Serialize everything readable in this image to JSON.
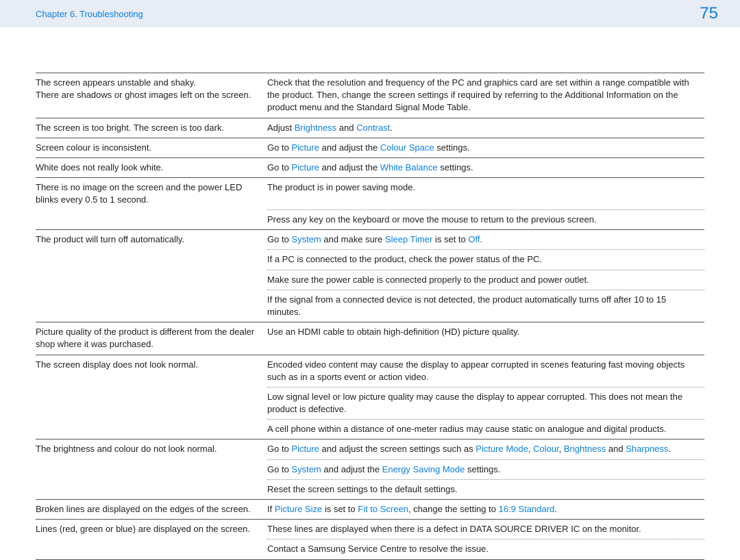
{
  "header": {
    "chapter": "Chapter 6. Troubleshooting",
    "page": "75"
  },
  "rows": [
    {
      "issue": "The screen appears unstable and shaky.\nThere are shadows or ghost images left on the screen.",
      "solutions": [
        {
          "segments": [
            {
              "t": "Check that the resolution and frequency of the PC and graphics card are set within a range compatible with the product. Then, change the screen settings if required by referring to the Additional Information on the product menu and the Standard Signal Mode Table."
            }
          ]
        }
      ]
    },
    {
      "issue": "The screen is too bright. The screen is too dark.",
      "solutions": [
        {
          "segments": [
            {
              "t": "Adjust "
            },
            {
              "t": "Brightness",
              "link": true
            },
            {
              "t": " and "
            },
            {
              "t": "Contrast",
              "link": true
            },
            {
              "t": "."
            }
          ]
        }
      ]
    },
    {
      "issue": "Screen colour is inconsistent.",
      "solutions": [
        {
          "segments": [
            {
              "t": "Go to "
            },
            {
              "t": "Picture",
              "link": true
            },
            {
              "t": " and adjust the "
            },
            {
              "t": "Colour Space",
              "link": true
            },
            {
              "t": " settings."
            }
          ]
        }
      ]
    },
    {
      "issue": "White does not really look white.",
      "solutions": [
        {
          "segments": [
            {
              "t": "Go to "
            },
            {
              "t": "Picture",
              "link": true
            },
            {
              "t": " and adjust the "
            },
            {
              "t": "White Balance",
              "link": true
            },
            {
              "t": " settings."
            }
          ]
        }
      ]
    },
    {
      "issue": "There is no image on the screen and the power LED blinks every 0.5 to 1 second.",
      "solutions": [
        {
          "segments": [
            {
              "t": "The product is in power saving mode."
            }
          ]
        },
        {
          "segments": [
            {
              "t": "Press any key on the keyboard or move the mouse to return to the previous screen."
            }
          ]
        }
      ]
    },
    {
      "issue": "The product will turn off automatically.",
      "solutions": [
        {
          "segments": [
            {
              "t": "Go to "
            },
            {
              "t": "System",
              "link": true
            },
            {
              "t": " and make sure "
            },
            {
              "t": "Sleep Timer",
              "link": true
            },
            {
              "t": " is set to "
            },
            {
              "t": "Off",
              "link": true
            },
            {
              "t": "."
            }
          ]
        },
        {
          "segments": [
            {
              "t": "If a PC is connected to the product, check the power status of the PC."
            }
          ]
        },
        {
          "segments": [
            {
              "t": "Make sure the power cable is connected properly to the product and power outlet."
            }
          ]
        },
        {
          "segments": [
            {
              "t": "If the signal from a connected device is not detected, the product automatically turns off after 10 to 15 minutes."
            }
          ]
        }
      ]
    },
    {
      "issue": "Picture quality of the product is different from the dealer shop where it was purchased.",
      "solutions": [
        {
          "segments": [
            {
              "t": "Use an HDMI cable to obtain high-definition (HD) picture quality."
            }
          ]
        }
      ]
    },
    {
      "issue": "The screen display does not look normal.",
      "solutions": [
        {
          "segments": [
            {
              "t": "Encoded video content may cause the display to appear corrupted in scenes featuring fast moving objects such as in a sports event or action video."
            }
          ]
        },
        {
          "segments": [
            {
              "t": "Low signal level or low picture quality may cause the display to appear corrupted. This does not mean the product is defective."
            }
          ]
        },
        {
          "segments": [
            {
              "t": "A cell phone within a distance of one-meter radius may cause static on analogue and digital products."
            }
          ]
        }
      ]
    },
    {
      "issue": "The brightness and colour do not look normal.",
      "solutions": [
        {
          "segments": [
            {
              "t": "Go to "
            },
            {
              "t": "Picture",
              "link": true
            },
            {
              "t": " and adjust the screen settings such as "
            },
            {
              "t": "Picture Mode",
              "link": true
            },
            {
              "t": ", "
            },
            {
              "t": "Colour",
              "link": true
            },
            {
              "t": ", "
            },
            {
              "t": "Brightness",
              "link": true
            },
            {
              "t": " and "
            },
            {
              "t": "Sharpness",
              "link": true
            },
            {
              "t": "."
            }
          ]
        },
        {
          "segments": [
            {
              "t": "Go to "
            },
            {
              "t": "System",
              "link": true
            },
            {
              "t": " and adjust the "
            },
            {
              "t": "Energy Saving Mode",
              "link": true
            },
            {
              "t": " settings."
            }
          ]
        },
        {
          "segments": [
            {
              "t": "Reset the screen settings to the default settings."
            }
          ]
        }
      ]
    },
    {
      "issue": "Broken lines are displayed on the edges of the screen.",
      "solutions": [
        {
          "segments": [
            {
              "t": "If "
            },
            {
              "t": "Picture Size",
              "link": true
            },
            {
              "t": " is set to "
            },
            {
              "t": "Fit to Screen",
              "link": true
            },
            {
              "t": ", change the setting to "
            },
            {
              "t": "16:9 Standard",
              "link": true
            },
            {
              "t": "."
            }
          ]
        }
      ]
    },
    {
      "issue": "Lines (red, green or blue) are displayed on the screen.",
      "solutions": [
        {
          "segments": [
            {
              "t": "These lines are displayed when there is a defect in DATA SOURCE DRIVER IC on the monitor."
            }
          ]
        },
        {
          "segments": [
            {
              "t": "Contact a Samsung Service Centre to resolve the issue."
            }
          ]
        }
      ]
    }
  ]
}
